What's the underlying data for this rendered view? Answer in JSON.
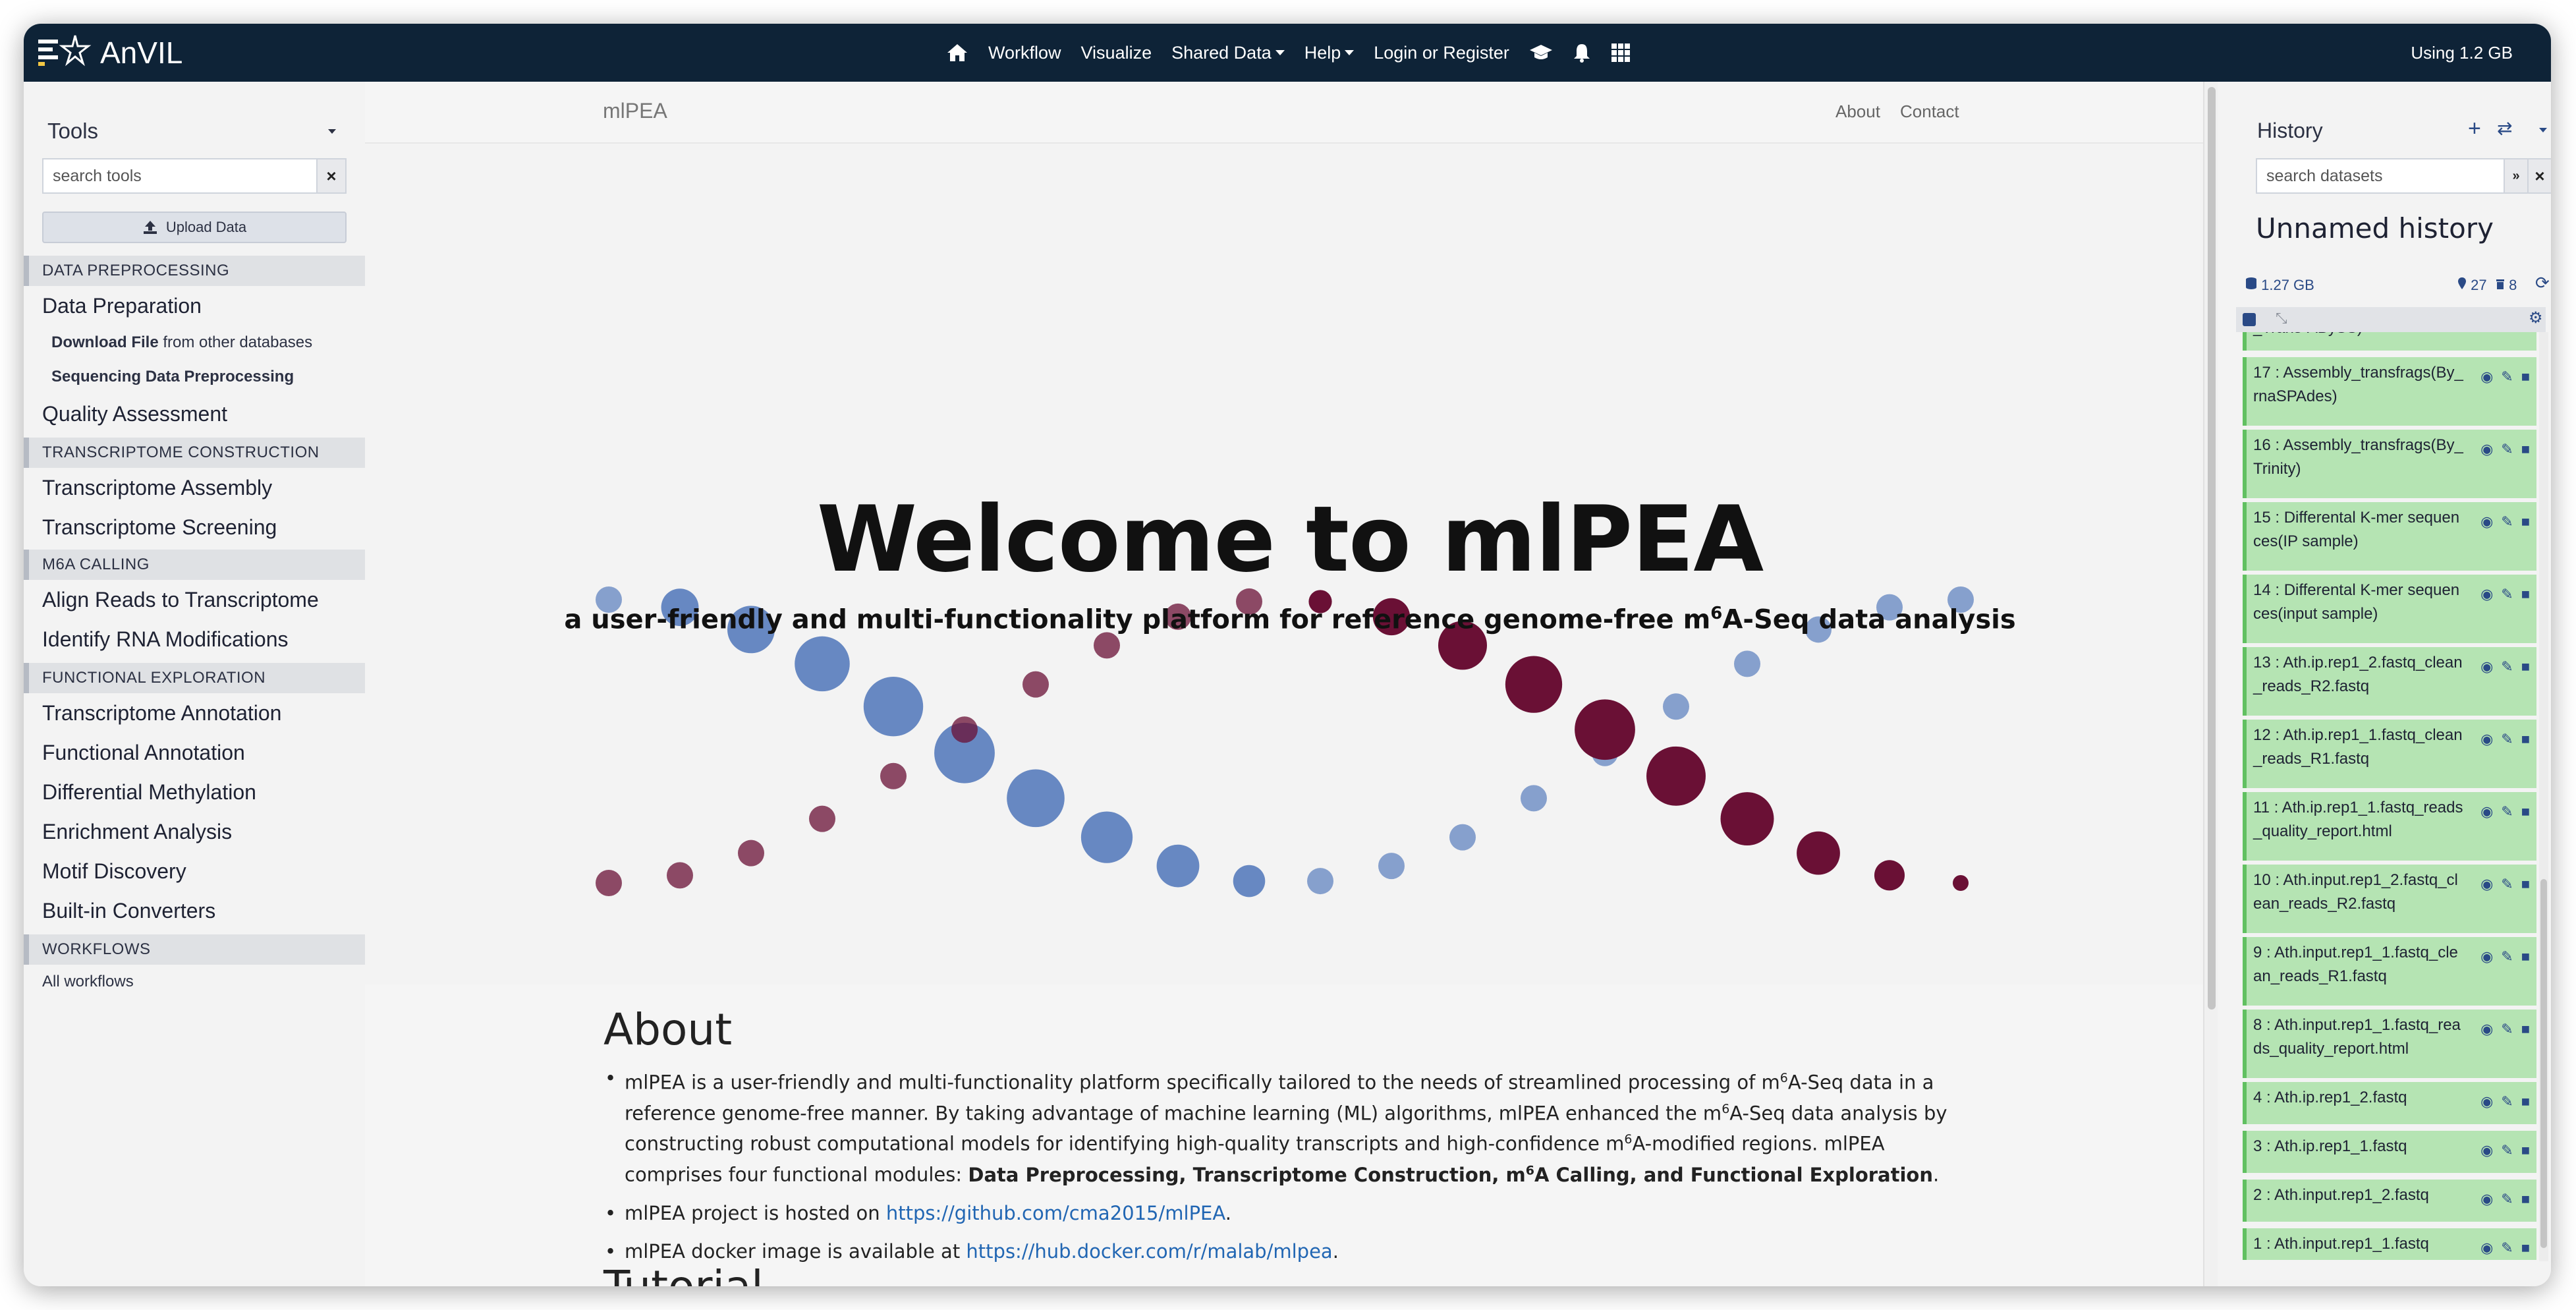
{
  "masthead": {
    "brand": "AnVIL",
    "nav": [
      {
        "label": "Workflow",
        "dropdown": false
      },
      {
        "label": "Visualize",
        "dropdown": false
      },
      {
        "label": "Shared Data",
        "dropdown": true
      },
      {
        "label": "Help",
        "dropdown": true
      },
      {
        "label": "Login or Register",
        "dropdown": false
      }
    ],
    "quota": "Using 1.2 GB",
    "icons": [
      "home-icon",
      "graduation-cap-icon",
      "bell-icon",
      "grid-icon"
    ]
  },
  "tools": {
    "title": "Tools",
    "search_placeholder": "search tools",
    "clear_label": "×",
    "upload_label": "Upload Data",
    "sections": [
      {
        "header": "DATA PREPROCESSING"
      },
      {
        "header": "TRANSCRIPTOME CONSTRUCTION"
      },
      {
        "header": "M6A CALLING"
      },
      {
        "header": "FUNCTIONAL EXPLORATION"
      },
      {
        "header": "WORKFLOWS"
      }
    ],
    "items": [
      "Data Preparation",
      "Quality Assessment",
      "Transcriptome Assembly",
      "Transcriptome Screening",
      "Align Reads to Transcriptome",
      "Identify RNA Modifications",
      "Transcriptome Annotation",
      "Functional Annotation",
      "Differential Methylation",
      "Enrichment Analysis",
      "Motif Discovery",
      "Built-in Converters"
    ],
    "sub_items": [
      {
        "bold": "Download File",
        "rest": " from other databases"
      },
      {
        "bold": "Sequencing Data Preprocessing",
        "rest": ""
      }
    ],
    "all_workflows": "All workflows"
  },
  "center": {
    "brand": "mlPEA",
    "links": [
      "About",
      "Contact"
    ],
    "hero_title": "Welcome to mlPEA",
    "hero_sub": {
      "a": "a user-friendly and multi-functionality platform for reference genome-free m",
      "sup": "6",
      "b": "A-Seq data analysis"
    },
    "about_title": "About",
    "about": {
      "p1_a": "mlPEA is a user-friendly and multi-functionality platform specifically tailored to the needs of streamlined processing of m",
      "p1_b": "A-Seq data in a reference genome-free manner. By taking advantage of machine learning (ML) algorithms, mlPEA enhanced the m",
      "p1_c": "A-Seq data analysis by constructing robust computational models for identifying high-quality transcripts and high-confidence m",
      "p1_d": "A-modified regions. mlPEA comprises four functional modules: ",
      "p1_bold_a": "Data Preprocessing, Transcriptome Construction, m",
      "p1_bold_b": "A Calling, and Functional Exploration",
      "p1_end": ".",
      "sup": "6",
      "p2": "mlPEA project is hosted on ",
      "p2_link": "https://github.com/cma2015/mlPEA",
      "p2_end": ".",
      "p3": "mlPEA docker image is available at ",
      "p3_link": "https://hub.docker.com/r/malab/mlpea",
      "p3_end": "."
    },
    "tutorial_title": "Tutorial"
  },
  "history": {
    "title": "History",
    "search_placeholder": "search datasets",
    "name": "Unnamed history",
    "size": "1.27 GB",
    "shown": "27",
    "deleted": "8",
    "partial_item": "_Trans-ABySS)",
    "datasets": [
      "17 : Assembly_transfrags(By_rnaSPAdes)",
      "16 : Assembly_transfrags(By_Trinity)",
      "15 : Differental K-mer sequences(IP sample)",
      "14 : Differental K-mer sequences(input sample)",
      "13 : Ath.ip.rep1_2.fastq_clean_reads_R2.fastq",
      "12 : Ath.ip.rep1_1.fastq_clean_reads_R1.fastq",
      "11 : Ath.ip.rep1_1.fastq_reads_quality_report.html",
      "10 : Ath.input.rep1_2.fastq_clean_reads_R2.fastq",
      "9 : Ath.input.rep1_1.fastq_clean_reads_R1.fastq",
      "8 : Ath.input.rep1_1.fastq_reads_quality_report.html",
      "4 : Ath.ip.rep1_2.fastq",
      "3 : Ath.ip.rep1_1.fastq",
      "2 : Ath.input.rep1_2.fastq",
      "1 : Ath.input.rep1_1.fastq"
    ]
  },
  "colors": {
    "masthead": "#0e2337",
    "dataset_ok": "#b5e4b3",
    "link": "#2166b3",
    "helix_blue": "#5b7fbe",
    "helix_maroon": "#6a1035"
  }
}
